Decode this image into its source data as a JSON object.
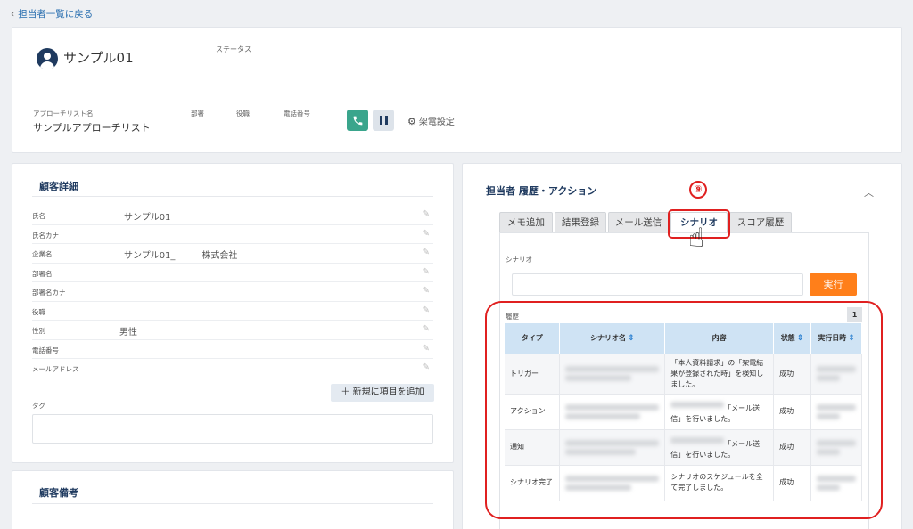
{
  "nav": {
    "back_label": "担当者一覧に戻る"
  },
  "header": {
    "name": "サンプル01",
    "status_label": "ステータス",
    "fields": {
      "approach_list_label": "アプローチリスト名",
      "approach_list_value": "サンプルアプローチリスト",
      "dept_label": "部署",
      "title_label": "役職",
      "phone_label": "電話番号"
    },
    "call_settings_label": "架電設定"
  },
  "detail": {
    "title": "顧客詳細",
    "rows": [
      {
        "label": "氏名",
        "value": "サンプル01"
      },
      {
        "label": "氏名カナ",
        "value": ""
      },
      {
        "label": "企業名",
        "value": "サンプル01_　　　株式会社"
      },
      {
        "label": "部署名",
        "value": ""
      },
      {
        "label": "部署名カナ",
        "value": ""
      },
      {
        "label": "役職",
        "value": ""
      },
      {
        "label": "性別",
        "value": "男性"
      },
      {
        "label": "電話番号",
        "value": ""
      },
      {
        "label": "メールアドレス",
        "value": ""
      }
    ],
    "add_item_label": "新規に項目を追加",
    "tag_label": "タグ"
  },
  "memo": {
    "title": "顧客備考"
  },
  "history": {
    "title": "担当者 履歴・アクション",
    "tabs": [
      "メモ追加",
      "結果登録",
      "メール送信",
      "シナリオ",
      "スコア履歴"
    ],
    "active_tab": "シナリオ",
    "scenario_label": "シナリオ",
    "run_label": "実行",
    "history_label": "履歴",
    "page": "1",
    "columns": [
      "タイプ",
      "シナリオ名",
      "内容",
      "状態",
      "実行日時"
    ],
    "rows": [
      {
        "type": "トリガー",
        "content": "「本人資料請求」の「架電結果が登録された時」を検知しました。",
        "state": "成功"
      },
      {
        "type": "アクション",
        "content": "「メール送信」を行いました。",
        "state": "成功"
      },
      {
        "type": "通知",
        "content": "「メール送信」を行いました。",
        "state": "成功"
      },
      {
        "type": "シナリオ完了",
        "content": "シナリオのスケジュールを全て完了しました。",
        "state": "成功"
      }
    ]
  },
  "annotation": {
    "step": "⑨"
  },
  "colors": {
    "accent": "#1f3a5f",
    "run_button": "#ff7f1a",
    "phone_button": "#3aa58c",
    "highlight": "#e02020",
    "table_header": "#cfe3f4"
  }
}
